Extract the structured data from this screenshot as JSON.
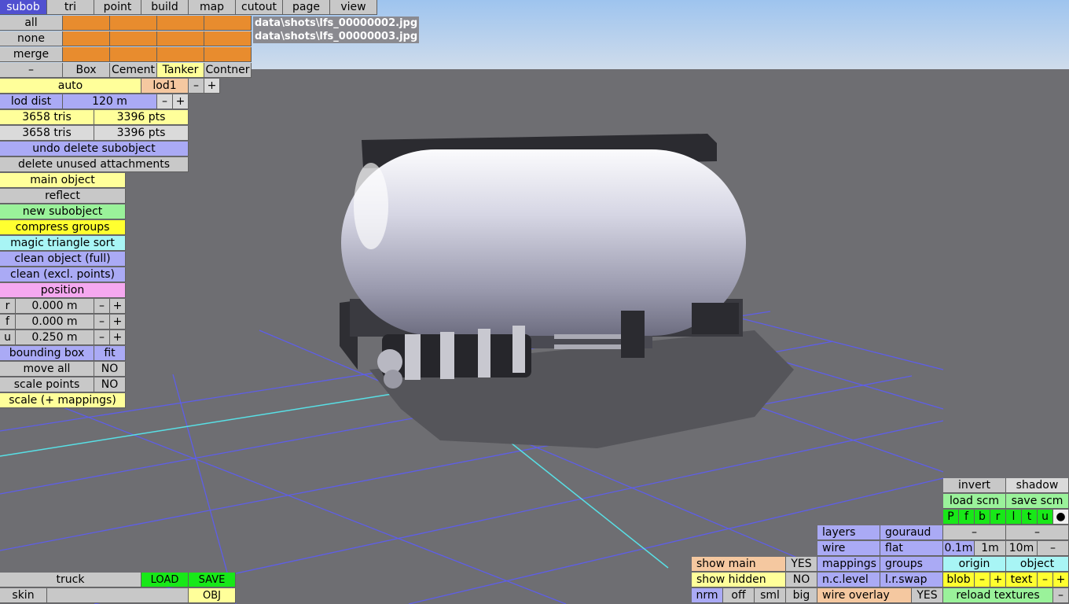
{
  "tabs": [
    "subob",
    "tri",
    "point",
    "build",
    "map",
    "cutout",
    "page",
    "view"
  ],
  "file_paths": [
    "data\\shots\\lfs_00000002.jpg",
    "data\\shots\\lfs_00000003.jpg"
  ],
  "left": {
    "all": "all",
    "none": "none",
    "merge": "merge",
    "minus": "–",
    "obj_types": [
      "Box",
      "Cement",
      "Tanker",
      "Contner"
    ],
    "auto": "auto",
    "lod": "lod1",
    "lod_minus": "–",
    "lod_plus": "+",
    "lod_dist_label": "lod dist",
    "lod_dist_value": "120 m",
    "lod_dist_minus": "–",
    "lod_dist_plus": "+",
    "tris1": "3658 tris",
    "pts1": "3396 pts",
    "tris2": "3658 tris",
    "pts2": "3396 pts",
    "undo_delete": "undo delete subobject",
    "delete_unused": "delete unused attachments",
    "main_object": "main object",
    "reflect": "reflect",
    "new_subobject": "new subobject",
    "compress_groups": "compress groups",
    "magic_sort": "magic triangle sort",
    "clean_full": "clean object (full)",
    "clean_excl": "clean (excl. points)",
    "position": "position",
    "coords": [
      {
        "axis": "r",
        "value": "0.000 m"
      },
      {
        "axis": "f",
        "value": "0.000 m"
      },
      {
        "axis": "u",
        "value": "0.250 m"
      }
    ],
    "coord_minus": "–",
    "coord_plus": "+",
    "bounding_box": "bounding box",
    "fit": "fit",
    "move_all": "move all",
    "move_all_val": "NO",
    "scale_points": "scale points",
    "scale_points_val": "NO",
    "scale_mappings": "scale (+ mappings)"
  },
  "bottom_left": {
    "truck": "truck",
    "load": "LOAD",
    "save": "SAVE",
    "skin": "skin",
    "obj": "OBJ"
  },
  "bottom_mid": {
    "show_main": "show main",
    "show_main_val": "YES",
    "show_hidden": "show hidden",
    "show_hidden_val": "NO",
    "nrm": "nrm",
    "off": "off",
    "sml": "sml",
    "big": "big"
  },
  "bottom_right": {
    "layers": "layers",
    "gouraud": "gouraud",
    "wire": "wire",
    "flat": "flat",
    "mappings": "mappings",
    "groups": "groups",
    "nc_level": "n.c.level",
    "lr_swap": "l.r.swap",
    "wire_overlay": "wire overlay",
    "wire_overlay_val": "YES",
    "invert": "invert",
    "shadow": "shadow",
    "load_scm": "load scm",
    "save_scm": "save scm",
    "flags": [
      "P",
      "f",
      "b",
      "r",
      "l",
      "t",
      "u",
      "●"
    ],
    "dash1": "–",
    "dash2": "–",
    "grid": [
      "0.1m",
      "1m",
      "10m",
      "–"
    ],
    "origin": "origin",
    "object": "object",
    "blob": "blob",
    "blob_minus": "–",
    "blob_plus": "+",
    "text": "text",
    "text_minus": "–",
    "text_plus": "+",
    "reload_textures": "reload textures",
    "reload_minus": "–"
  }
}
